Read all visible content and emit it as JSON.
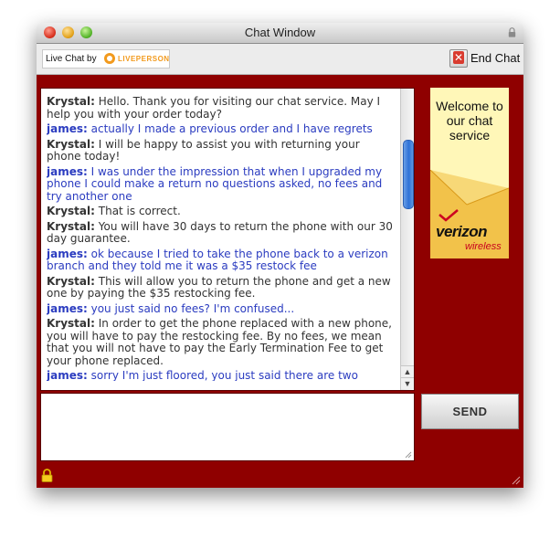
{
  "window": {
    "title": "Chat Window"
  },
  "toolbar": {
    "badge_prefix": "Live Chat by",
    "badge_brand": "LIVEPERSON",
    "end_chat_label": "End Chat"
  },
  "transcript": {
    "messages": [
      {
        "speaker": "Krystal:",
        "role": "agent",
        "text": " Hello. Thank you for visiting our chat service.  May I help you with your order today?"
      },
      {
        "speaker": "james:",
        "role": "user",
        "text": " actually I made a previous order and I have regrets"
      },
      {
        "speaker": "Krystal:",
        "role": "agent",
        "text": " I will be happy to assist you with returning your phone today!"
      },
      {
        "speaker": "james:",
        "role": "user",
        "text": " I was under the impression that when I upgraded my phone I could make a return no questions asked, no fees and try another one"
      },
      {
        "speaker": "Krystal:",
        "role": "agent",
        "text": " That is correct."
      },
      {
        "speaker": "Krystal:",
        "role": "agent",
        "text": " You will have 30 days to return the phone with our 30 day guarantee."
      },
      {
        "speaker": "james:",
        "role": "user",
        "text": " ok because I tried to take the phone back to a verizon branch and they told me it was a $35 restock fee"
      },
      {
        "speaker": "Krystal:",
        "role": "agent",
        "text": " This will allow you to return the phone and get a new one by paying the $35 restocking fee."
      },
      {
        "speaker": "james:",
        "role": "user",
        "text": " you just said no fees? I'm confused..."
      },
      {
        "speaker": "Krystal:",
        "role": "agent",
        "text": " In order to get the phone replaced with a new phone, you will have to pay the restocking fee. By no fees, we mean that you will not have to pay the Early Termination Fee to get your phone replaced."
      },
      {
        "speaker": "james:",
        "role": "user",
        "text": " sorry I'm just floored, you just said there are two"
      }
    ]
  },
  "ad": {
    "headline": "Welcome to our chat service",
    "brand": "verizon",
    "brand_sub": "wireless"
  },
  "composer": {
    "value": "",
    "send_label": "SEND"
  },
  "colors": {
    "background_panel": "#8f0000",
    "agent_text": "#333333",
    "user_text": "#2b3cc0",
    "ad_background": "#fff7b8",
    "scroll_thumb": "#2e72d8"
  }
}
